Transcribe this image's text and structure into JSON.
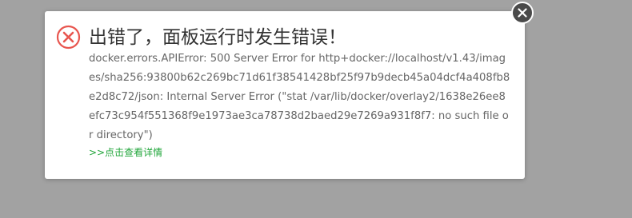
{
  "dialog": {
    "title": "出错了，面板运行时发生错误！",
    "message": "docker.errors.APIError: 500 Server Error for http+docker://localhost/v1.43/images/sha256:93800b62c269bc71d61f38541428bf25f97b9decb45a04dcf4a408fb8e2d8c72/json: Internal Server Error (\"stat /var/lib/docker/overlay2/1638e26ee8efc73c954f551368f9e1973ae3ca78738d2baed29e7269a931f8f7: no such file or directory\")",
    "details_link": ">>点击查看详情",
    "icons": {
      "error": "error-circle-x-icon",
      "close": "close-icon"
    }
  },
  "colors": {
    "overlay": "#a2a2a2",
    "error_red": "#e8564f",
    "link_green": "#20a53a",
    "close_bg": "#4a4a4a",
    "title_text": "#333333",
    "message_text": "#666666"
  }
}
